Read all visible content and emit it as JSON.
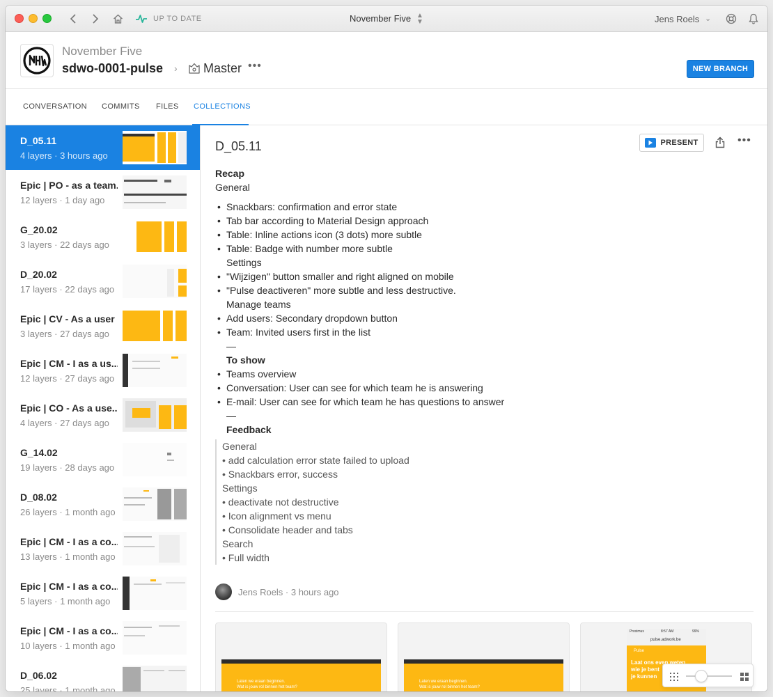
{
  "app": {
    "sync_status": "UP TO DATE",
    "window_title": "November Five",
    "user_name": "Jens Roels"
  },
  "header": {
    "org_name": "November Five",
    "project_name": "sdwo-0001-pulse",
    "branch_name": "Master",
    "new_branch_label": "NEW BRANCH"
  },
  "tabs": [
    {
      "label": "CONVERSATION"
    },
    {
      "label": "COMMITS"
    },
    {
      "label": "FILES"
    },
    {
      "label": "COLLECTIONS",
      "active": true
    }
  ],
  "collections": [
    {
      "name": "D_05.11",
      "meta": "4 layers · 3 hours ago",
      "selected": true
    },
    {
      "name": "Epic | PO - as a team...",
      "meta": "12 layers · 1 day ago"
    },
    {
      "name": "G_20.02",
      "meta": "3 layers · 22 days ago"
    },
    {
      "name": "D_20.02",
      "meta": "17 layers · 22 days ago"
    },
    {
      "name": "Epic | CV - As a user I...",
      "meta": "3 layers · 27 days ago"
    },
    {
      "name": "Epic | CM - I as a us...",
      "meta": "12 layers · 27 days ago"
    },
    {
      "name": "Epic | CO - As a use...",
      "meta": "4 layers · 27 days ago"
    },
    {
      "name": "G_14.02",
      "meta": "19 layers · 28 days ago"
    },
    {
      "name": "D_08.02",
      "meta": "26 layers · 1 month ago"
    },
    {
      "name": "Epic | CM - I as a co...",
      "meta": "13 layers · 1 month ago"
    },
    {
      "name": "Epic | CM - I as a co...",
      "meta": "5 layers · 1 month ago"
    },
    {
      "name": "Epic | CM - I as a co...",
      "meta": "10 layers · 1 month ago"
    },
    {
      "name": "D_06.02",
      "meta": "25 layers · 1 month ago"
    }
  ],
  "document": {
    "title": "D_05.11",
    "present_label": "PRESENT",
    "recap_heading": "Recap",
    "recap_sub": "General",
    "lines": [
      {
        "text": "Snackbars: confirmation and error state",
        "kind": "bullet"
      },
      {
        "text": "Tab bar according to Material Design approach",
        "kind": "bullet"
      },
      {
        "text": "Table: Inline actions icon (3 dots) more subtle",
        "kind": "bullet"
      },
      {
        "text": "Table: Badge with number more subtle",
        "kind": "bullet"
      },
      {
        "text": "Settings",
        "kind": "indent"
      },
      {
        "text": "\"Wijzigen\" button smaller and right aligned on mobile",
        "kind": "bullet"
      },
      {
        "text": "\"Pulse deactiveren\" more subtle and less destructive.",
        "kind": "bullet"
      },
      {
        "text": "Manage teams",
        "kind": "indent"
      },
      {
        "text": "Add users: Secondary dropdown button",
        "kind": "bullet"
      },
      {
        "text": "Team: Invited users first in the list",
        "kind": "bullet"
      },
      {
        "text": "—",
        "kind": "indent"
      },
      {
        "text": "To show",
        "kind": "indent-bold"
      },
      {
        "text": "Teams overview",
        "kind": "bullet"
      },
      {
        "text": "Conversation: User can see for which team he is answering",
        "kind": "bullet"
      },
      {
        "text": "E-mail: User can see for which team he has questions to answer",
        "kind": "bullet"
      },
      {
        "text": "—",
        "kind": "indent"
      },
      {
        "text": "Feedback",
        "kind": "indent-bold"
      }
    ],
    "feedback": [
      "General",
      "• add calculation error state failed to upload",
      "• Snackbars error, success",
      "Settings",
      "• deactivate not destructive",
      "• Icon alignment vs menu",
      "• Consolidate header and tabs",
      "Search",
      "• Full width"
    ],
    "author": "Jens Roels · 3 hours ago"
  },
  "previews": [
    {
      "text_line1": "Laten we eraan beginnen.",
      "text_line2": "Wat is jouw rol binnen het team?"
    },
    {
      "text_line1": "Laten we eraan beginnen.",
      "text_line2": "Wat is jouw rol binnen het team?"
    },
    {
      "status_time": "8:57 AM",
      "status_carrier": "Proximus",
      "status_battery": "99%",
      "url": "pulse.adwork.be",
      "brand": "Pulse",
      "text_line1": "Laat ons even weten",
      "text_line2": "wie je bent",
      "text_line3": "je kunnen"
    }
  ],
  "colors": {
    "accent": "#1a82e2",
    "brand_yellow": "#fdb813"
  }
}
